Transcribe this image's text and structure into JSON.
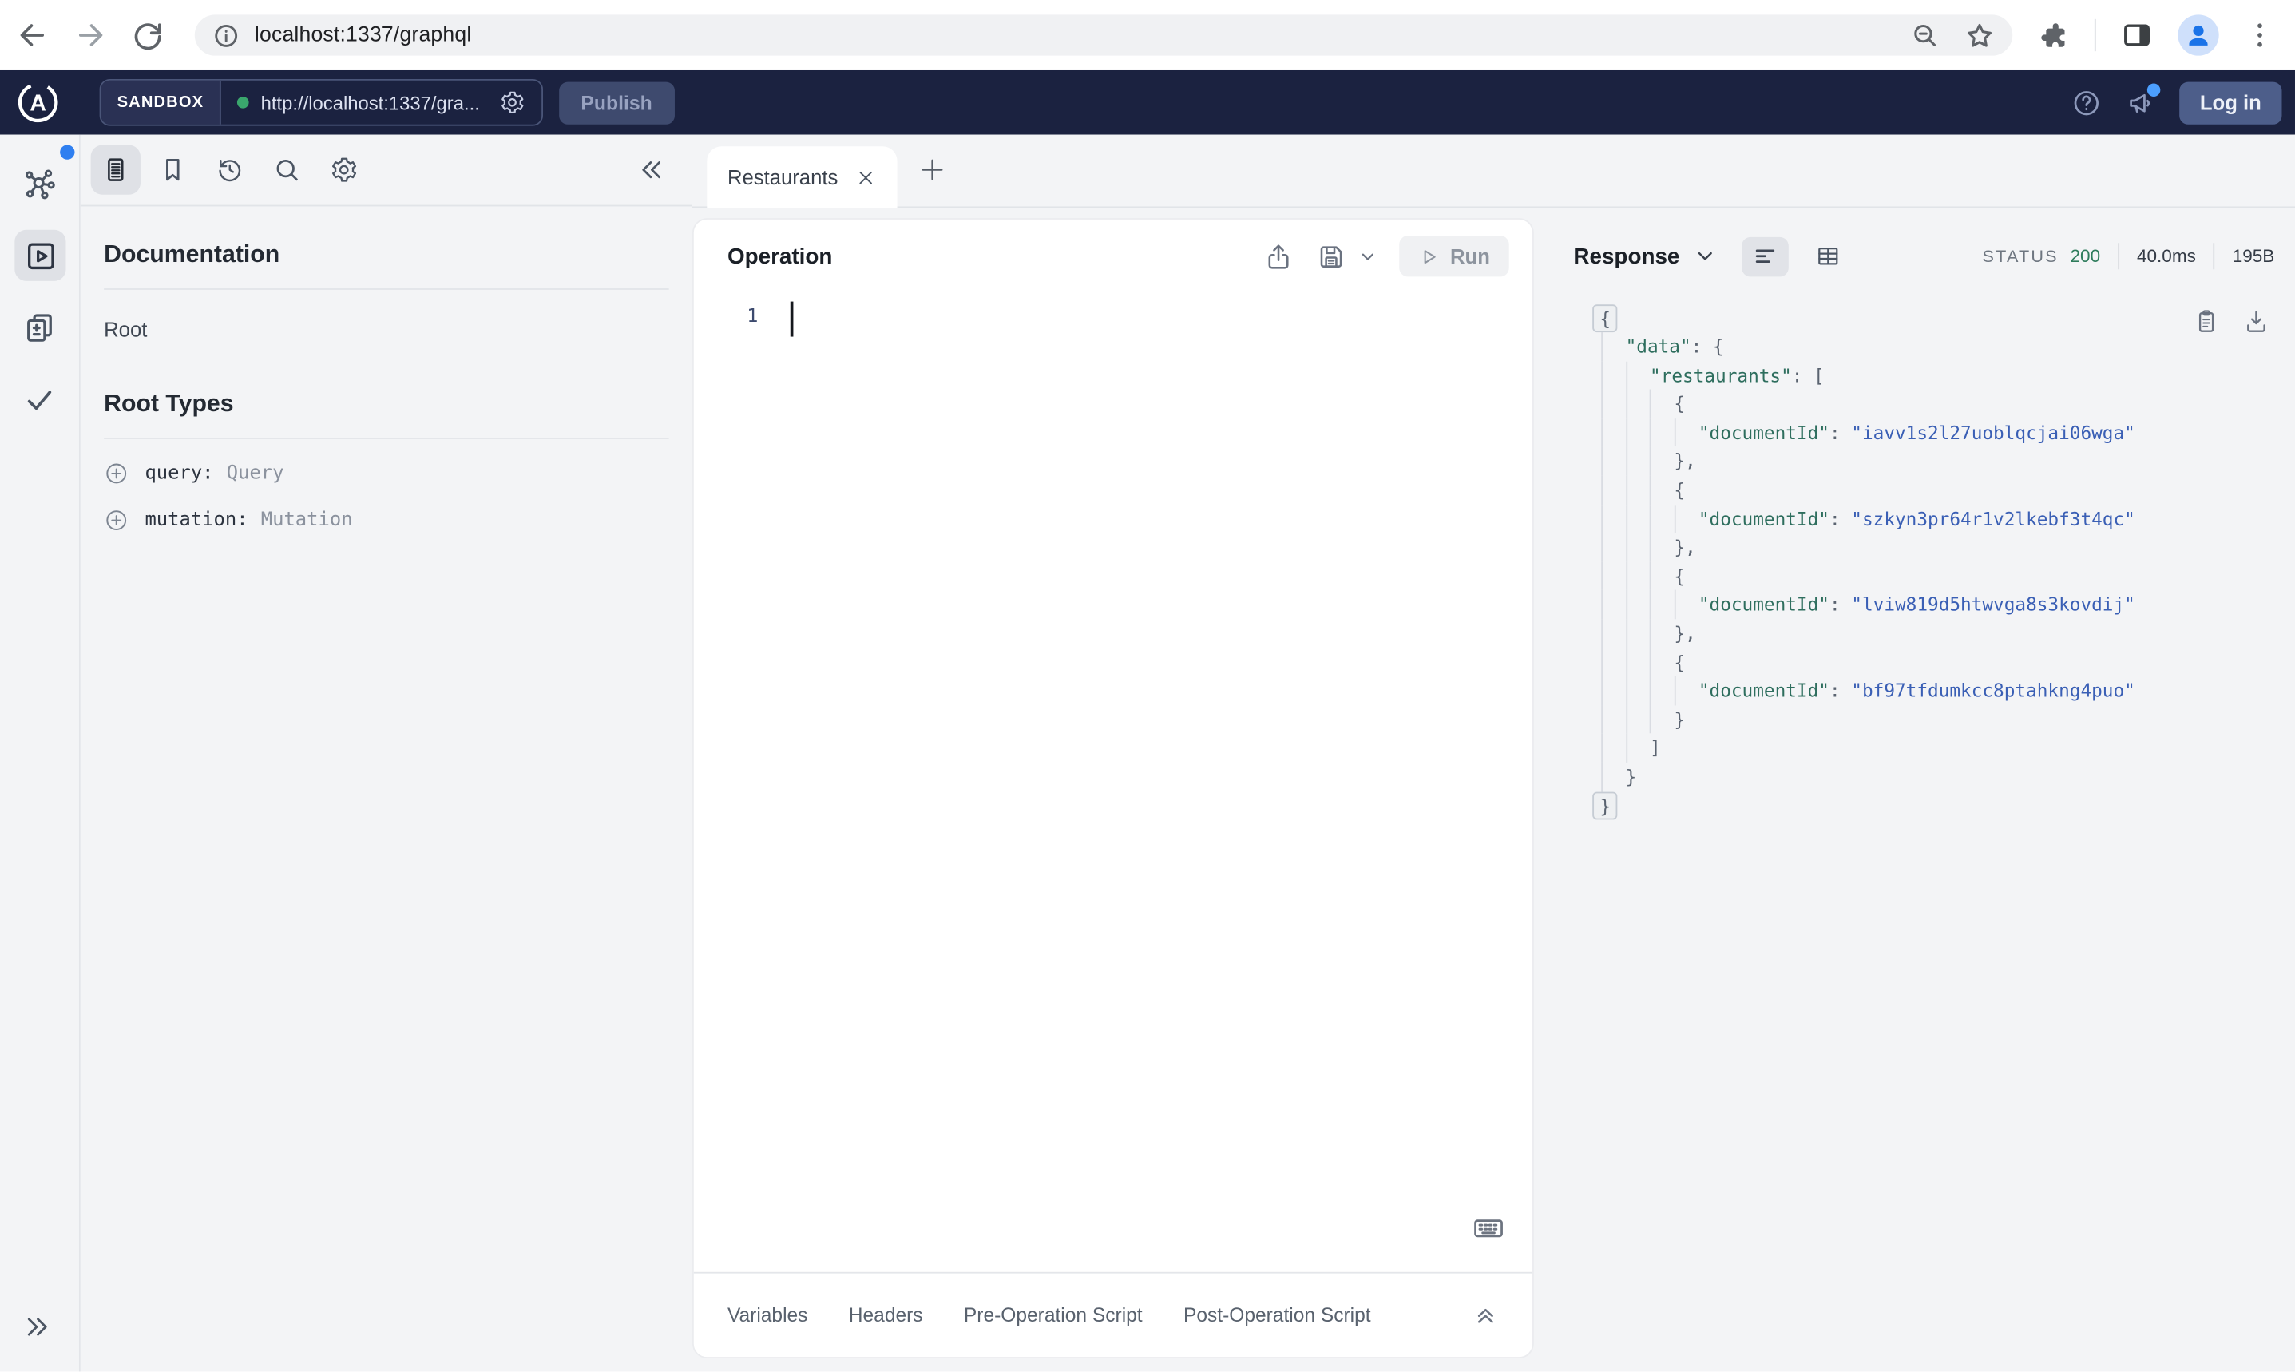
{
  "colors": {
    "apollo_header_bg": "#1b2240",
    "endpoint_status_green": "#3aa76d",
    "status_code_green": "#2e7c5c",
    "json_key_teal": "#2e6e5e",
    "json_string_blue": "#3a5fb5",
    "notification_blue": "#4c9ffe",
    "panel_gray": "#f3f4f6"
  },
  "browser": {
    "url": "localhost:1337/graphql",
    "icons": [
      "back-icon",
      "forward-icon",
      "reload-icon",
      "site-info-icon",
      "zoom-out-icon",
      "bookmark-star-icon",
      "extensions-icon",
      "side-panel-icon",
      "profile-avatar",
      "menu-dots-icon"
    ]
  },
  "apollo_header": {
    "env_badge": "SANDBOX",
    "endpoint_url": "http://localhost:1337/gra...",
    "publish_button": "Publish",
    "login_button": "Log in",
    "icons": [
      "apollo-logo",
      "gear-icon",
      "help-icon",
      "megaphone-icon"
    ]
  },
  "left_rail": {
    "icons": [
      "graph-icon",
      "explorer-play-icon",
      "diff-docs-icon",
      "checklist-icon",
      "expand-chevrons-right-icon"
    ],
    "active_item": "explorer-play-icon"
  },
  "docs_panel": {
    "toolbar_icons": [
      "documentation-icon",
      "bookmark-icon",
      "history-icon",
      "search-icon",
      "settings-gear-icon",
      "collapse-chevrons-left-icon"
    ],
    "title": "Documentation",
    "root_link": "Root",
    "section_title": "Root Types",
    "fields": [
      {
        "name": "query:",
        "type": "Query"
      },
      {
        "name": "mutation:",
        "type": "Mutation"
      }
    ]
  },
  "editor": {
    "tab_title": "Restaurants",
    "panel_title": "Operation",
    "run_button": "Run",
    "line_number": "1",
    "toolbar_icons": [
      "share-icon",
      "save-icon",
      "chevron-down-icon",
      "play-icon",
      "keyboard-icon"
    ],
    "footer_tabs": [
      "Variables",
      "Headers",
      "Pre-Operation Script",
      "Post-Operation Script"
    ]
  },
  "response_panel": {
    "title": "Response",
    "status_label": "STATUS",
    "status_code": "200",
    "duration": "40.0ms",
    "size": "195B",
    "view_icons": [
      "format-lines-icon",
      "table-view-icon"
    ],
    "corner_icons": [
      "copy-clipboard-icon",
      "download-icon"
    ],
    "json_lines": [
      {
        "ind": 0,
        "fold": true,
        "tokens": [
          [
            "p",
            "{"
          ]
        ]
      },
      {
        "ind": 1,
        "tokens": [
          [
            "k",
            "\"data\""
          ],
          [
            "p",
            ": {"
          ]
        ]
      },
      {
        "ind": 2,
        "tokens": [
          [
            "k",
            "\"restaurants\""
          ],
          [
            "p",
            ": ["
          ]
        ]
      },
      {
        "ind": 3,
        "tokens": [
          [
            "p",
            "{"
          ]
        ]
      },
      {
        "ind": 4,
        "tokens": [
          [
            "k",
            "\"documentId\""
          ],
          [
            "p",
            ": "
          ],
          [
            "s",
            "\"iavv1s2l27uoblqcjai06wga\""
          ]
        ]
      },
      {
        "ind": 3,
        "tokens": [
          [
            "p",
            "},"
          ]
        ]
      },
      {
        "ind": 3,
        "tokens": [
          [
            "p",
            "{"
          ]
        ]
      },
      {
        "ind": 4,
        "tokens": [
          [
            "k",
            "\"documentId\""
          ],
          [
            "p",
            ": "
          ],
          [
            "s",
            "\"szkyn3pr64r1v2lkebf3t4qc\""
          ]
        ]
      },
      {
        "ind": 3,
        "tokens": [
          [
            "p",
            "},"
          ]
        ]
      },
      {
        "ind": 3,
        "tokens": [
          [
            "p",
            "{"
          ]
        ]
      },
      {
        "ind": 4,
        "tokens": [
          [
            "k",
            "\"documentId\""
          ],
          [
            "p",
            ": "
          ],
          [
            "s",
            "\"lviw819d5htwvga8s3kovdij\""
          ]
        ]
      },
      {
        "ind": 3,
        "tokens": [
          [
            "p",
            "},"
          ]
        ]
      },
      {
        "ind": 3,
        "tokens": [
          [
            "p",
            "{"
          ]
        ]
      },
      {
        "ind": 4,
        "tokens": [
          [
            "k",
            "\"documentId\""
          ],
          [
            "p",
            ": "
          ],
          [
            "s",
            "\"bf97tfdumkcc8ptahkng4puo\""
          ]
        ]
      },
      {
        "ind": 3,
        "tokens": [
          [
            "p",
            "}"
          ]
        ]
      },
      {
        "ind": 2,
        "tokens": [
          [
            "p",
            "]"
          ]
        ]
      },
      {
        "ind": 1,
        "tokens": [
          [
            "p",
            "}"
          ]
        ]
      },
      {
        "ind": 0,
        "fold": true,
        "tokens": [
          [
            "p",
            "}"
          ]
        ]
      }
    ]
  }
}
